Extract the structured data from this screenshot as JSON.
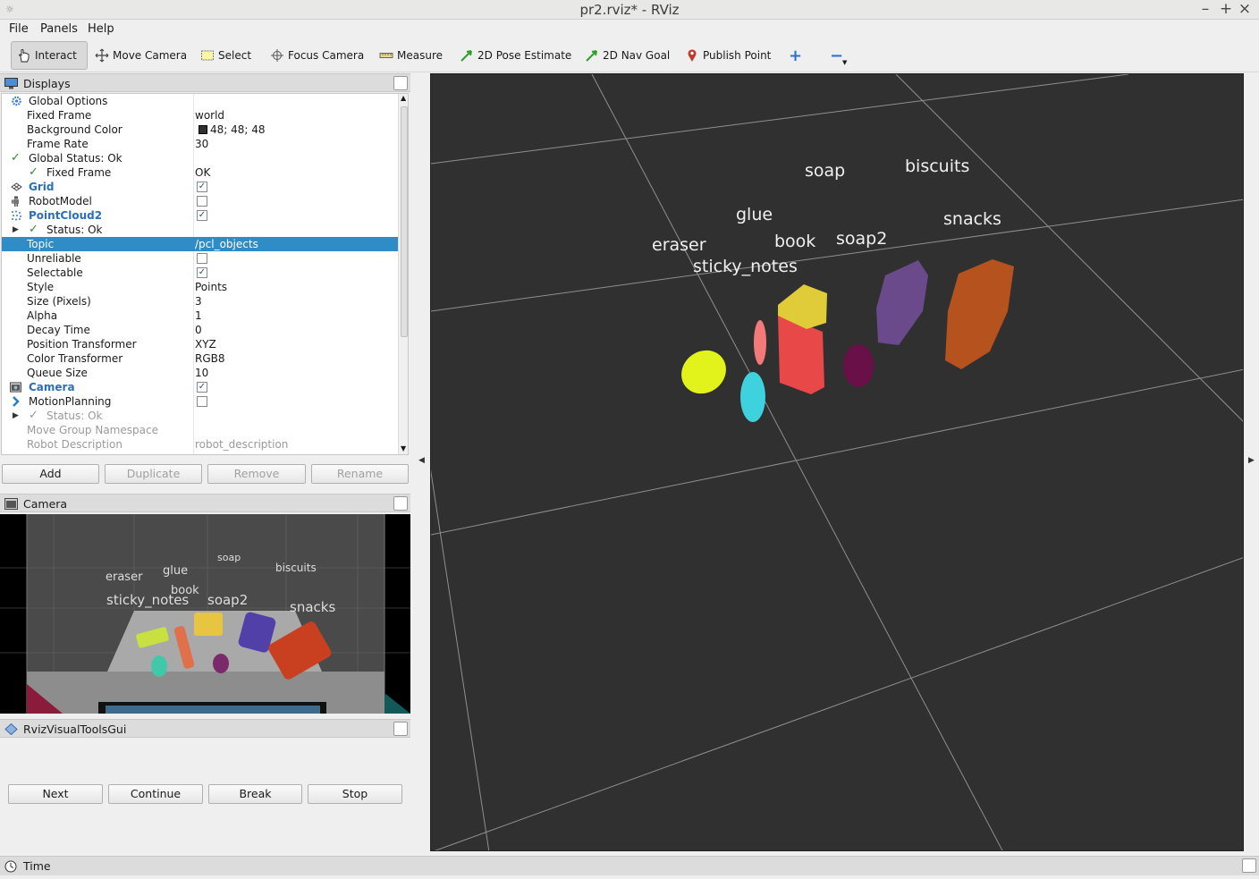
{
  "window": {
    "title": "pr2.rviz* - RViz",
    "wm_icon": "☼",
    "minimize": "–",
    "maximize": "+",
    "close": "×"
  },
  "menu": {
    "file": "File",
    "panels": "Panels",
    "help": "Help"
  },
  "toolbar": {
    "interact": "Interact",
    "move_camera": "Move Camera",
    "select": "Select",
    "focus_camera": "Focus Camera",
    "measure": "Measure",
    "pose_estimate": "2D Pose Estimate",
    "nav_goal": "2D Nav Goal",
    "publish_point": "Publish Point",
    "add_tool": "+",
    "remove_tool": "−"
  },
  "displays": {
    "title": "Displays",
    "rows": [
      {
        "name": "Global Options",
        "value": ""
      },
      {
        "name": "Fixed Frame",
        "value": "world"
      },
      {
        "name": "Background Color",
        "value": "48; 48; 48"
      },
      {
        "name": "Frame Rate",
        "value": "30"
      },
      {
        "name": "Global Status: Ok",
        "value": ""
      },
      {
        "name": "Fixed Frame",
        "value": "OK"
      },
      {
        "name": "Grid",
        "value": ""
      },
      {
        "name": "RobotModel",
        "value": ""
      },
      {
        "name": "PointCloud2",
        "value": ""
      },
      {
        "name": "Status: Ok",
        "value": ""
      },
      {
        "name": "Topic",
        "value": "/pcl_objects"
      },
      {
        "name": "Unreliable",
        "value": ""
      },
      {
        "name": "Selectable",
        "value": ""
      },
      {
        "name": "Style",
        "value": "Points"
      },
      {
        "name": "Size (Pixels)",
        "value": "3"
      },
      {
        "name": "Alpha",
        "value": "1"
      },
      {
        "name": "Decay Time",
        "value": "0"
      },
      {
        "name": "Position Transformer",
        "value": "XYZ"
      },
      {
        "name": "Color Transformer",
        "value": "RGB8"
      },
      {
        "name": "Queue Size",
        "value": "10"
      },
      {
        "name": "Camera",
        "value": ""
      },
      {
        "name": "MotionPlanning",
        "value": ""
      },
      {
        "name": "Status: Ok",
        "value": ""
      },
      {
        "name": "Move Group Namespace",
        "value": ""
      },
      {
        "name": "Robot Description",
        "value": "robot_description"
      }
    ],
    "checkboxes": {
      "grid": "✓",
      "robotmodel": "",
      "pointcloud2": "✓",
      "unreliable": "",
      "selectable": "✓",
      "camera": "✓",
      "motionplanning": ""
    },
    "background_color_swatch": "#303030",
    "buttons": {
      "add": "Add",
      "duplicate": "Duplicate",
      "remove": "Remove",
      "rename": "Rename"
    }
  },
  "camera_panel": {
    "title": "Camera",
    "labels": {
      "eraser": "eraser",
      "glue": "glue",
      "soap": "soap",
      "biscuits": "biscuits",
      "book": "book",
      "sticky_notes": "sticky_notes",
      "soap2": "soap2",
      "snacks": "snacks"
    }
  },
  "rviz_visual_tools": {
    "title": "RvizVisualToolsGui",
    "buttons": {
      "next": "Next",
      "continue": "Continue",
      "break": "Break",
      "stop": "Stop"
    }
  },
  "view3d": {
    "background": "#303030",
    "labels": {
      "soap": "soap",
      "biscuits": "biscuits",
      "glue": "glue",
      "snacks": "snacks",
      "eraser": "eraser",
      "book": "book",
      "soap2": "soap2",
      "sticky_notes": "sticky_notes"
    },
    "object_colors": {
      "eraser": "#e2f31c",
      "glue": "#f47a7a",
      "book": "#e84848",
      "soap": "#e0cc38",
      "soap2": "#6a1048",
      "biscuits": "#6b4a8c",
      "snacks": "#b5521e",
      "sticky_notes": "#3dd2de"
    }
  },
  "time_panel": {
    "title": "Time"
  }
}
